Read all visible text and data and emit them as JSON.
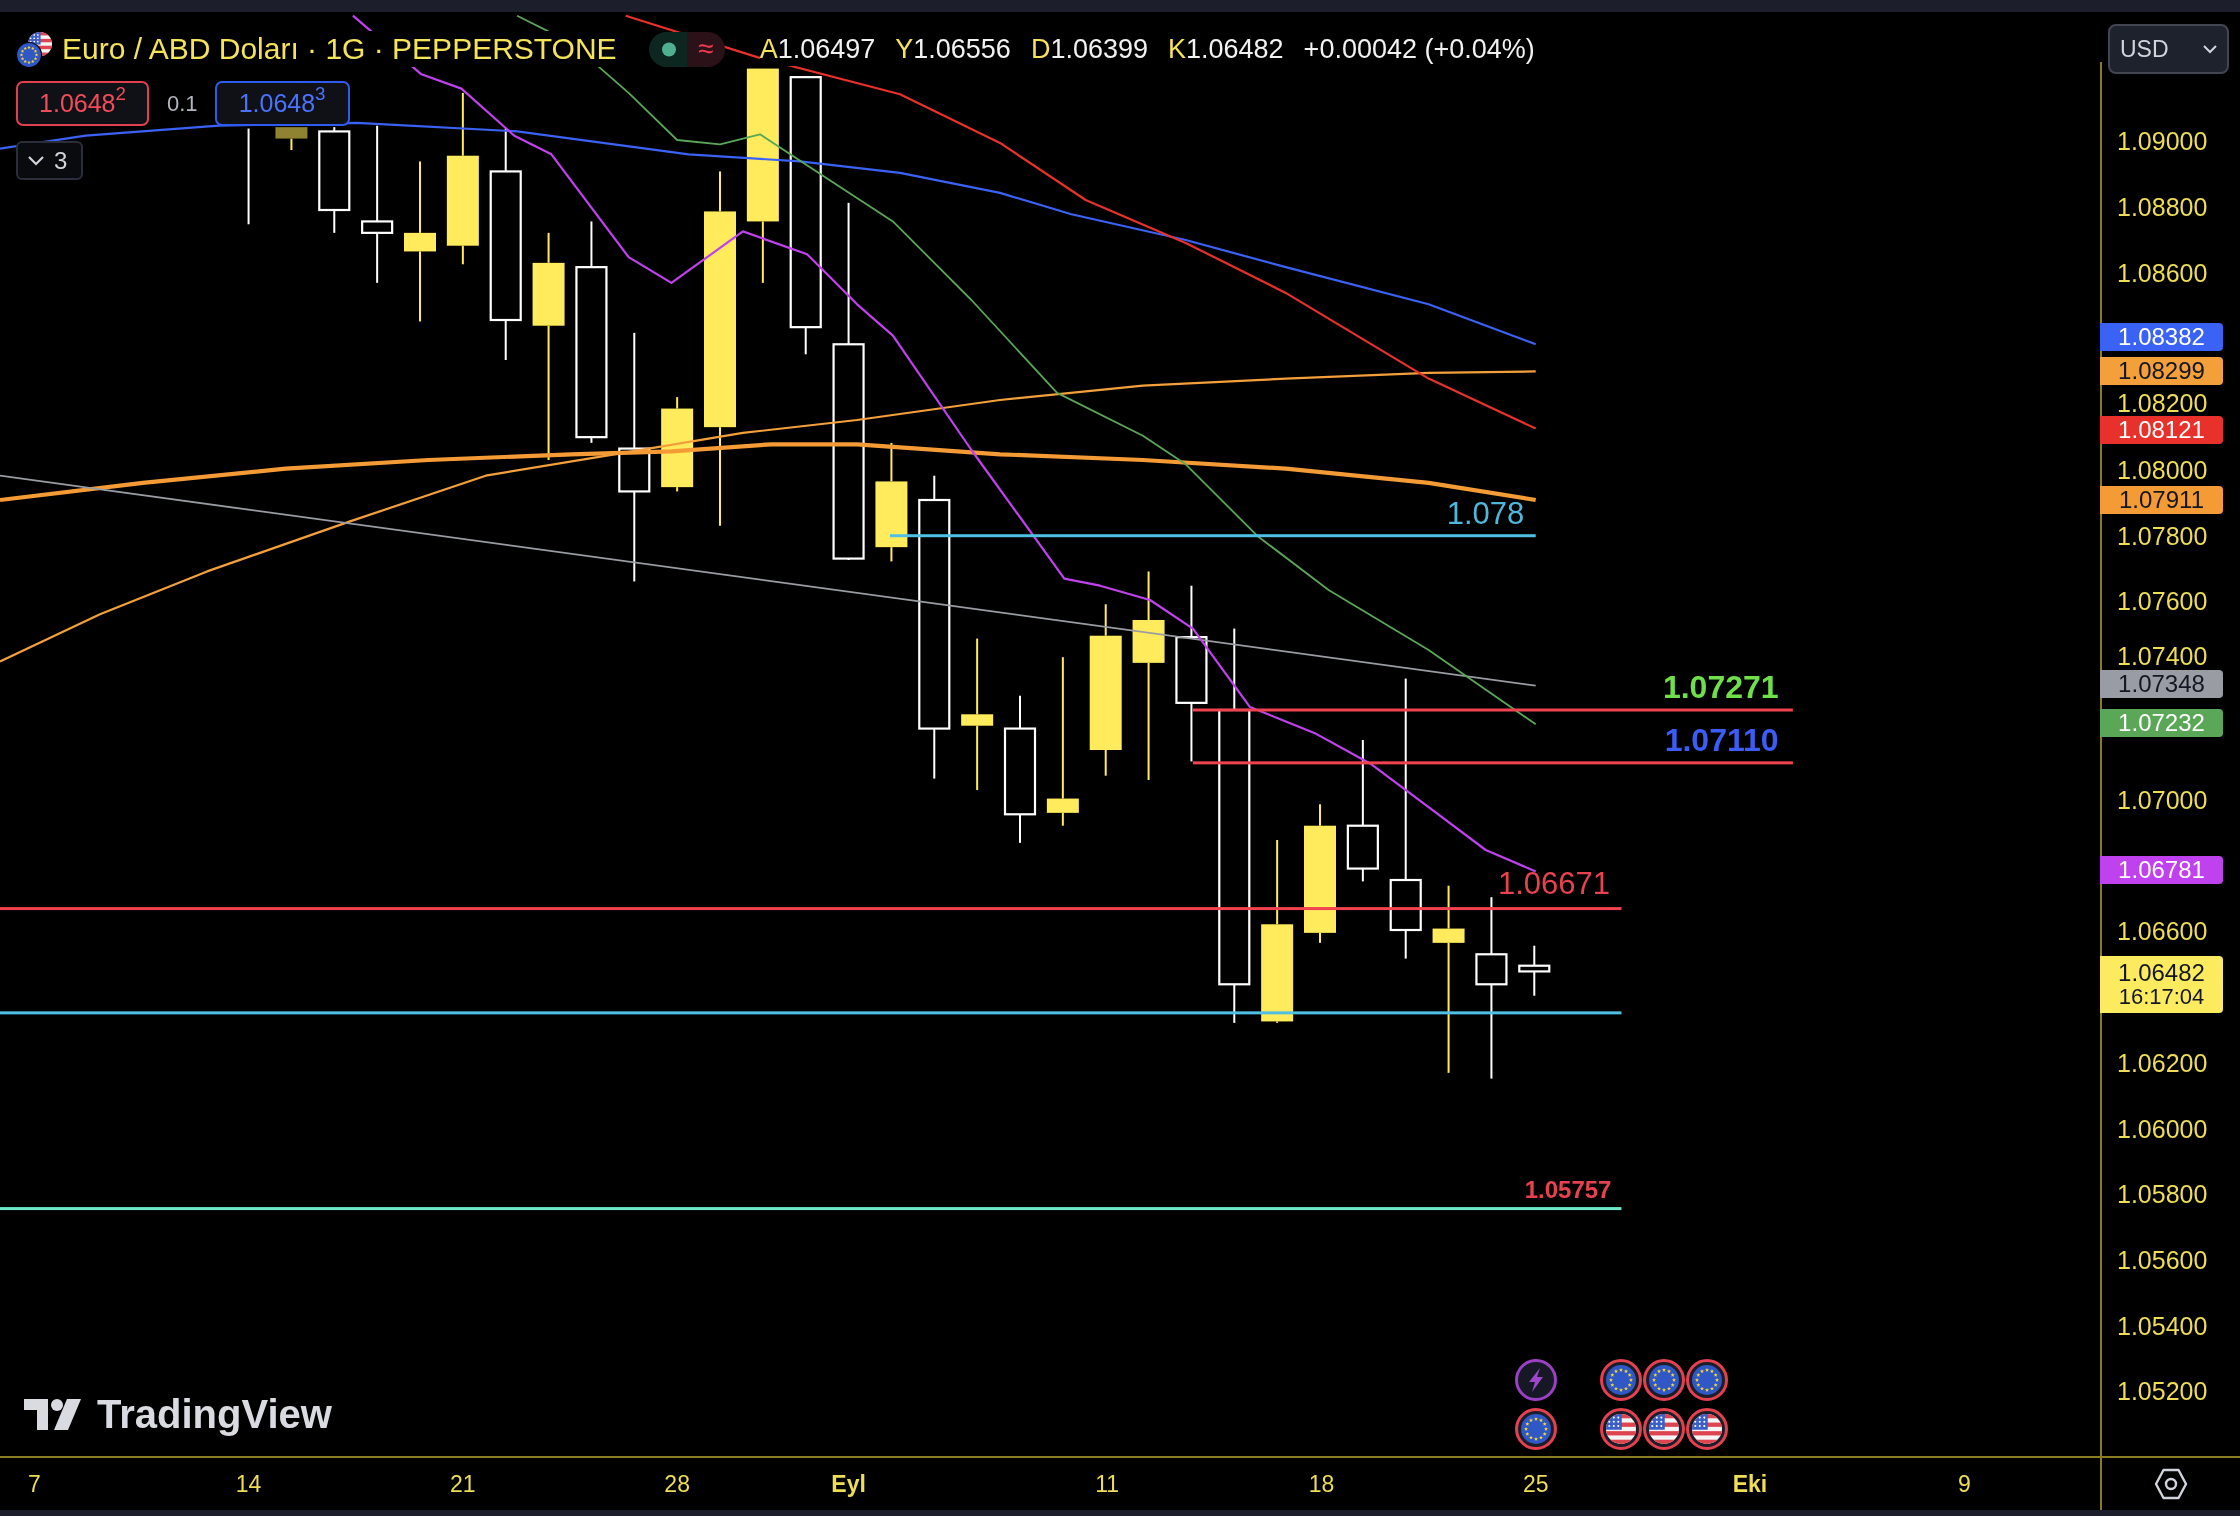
{
  "legend": {
    "symbol": "Euro / ABD Doları · 1G · PEPPERSTONE",
    "market_open": true,
    "data_flag": "≈",
    "ohlc": [
      {
        "key": "A",
        "value": "1.06497"
      },
      {
        "key": "Y",
        "value": "1.06556"
      },
      {
        "key": "D",
        "value": "1.06399"
      },
      {
        "key": "K",
        "value": "1.06482"
      }
    ],
    "change": "+0.00042 (+0.04%)"
  },
  "trade": {
    "sell": "1.0648$^{2}$",
    "spread": "0.1",
    "buy": "1.0648$^{3}$"
  },
  "indicators_toggle": {
    "count": "3",
    "expanded": false
  },
  "currency": "USD",
  "chart": {
    "indicators": [
      {
        "kind": "moving_average",
        "color": "#3a62f5",
        "reading": "1.08382"
      },
      {
        "kind": "moving_average",
        "color": "#f4a03a",
        "reading": "1.08299"
      },
      {
        "kind": "moving_average",
        "color": "#e8312a",
        "reading": "1.08121"
      },
      {
        "kind": "moving_average",
        "color": "#f59b35",
        "reading": "1.07911"
      },
      {
        "kind": "trend_line",
        "color": "#9a9ca3",
        "reading": "1.07348"
      },
      {
        "kind": "moving_average",
        "color": "#5aa757",
        "reading": "1.07232"
      },
      {
        "kind": "moving_average",
        "color": "#c041ee",
        "reading": "1.06781"
      }
    ],
    "levels": [
      {
        "color": "#4fc0e3",
        "label": {
          "text": "1.078",
          "color": "#4fb6dc",
          "bold": false
        }
      },
      {
        "color": "#f0424f",
        "label": {
          "text": "1.07271",
          "color": "#6fe04a",
          "bold": true
        }
      },
      {
        "color": "#f0424f",
        "label": {
          "text": "1.07110",
          "color": "#3b5cf5",
          "bold": true
        }
      },
      {
        "color": "#f0424f",
        "label": {
          "text": "1.06671",
          "color": "#e8414f",
          "bold": false
        }
      },
      {
        "color": "#4fc0e3"
      },
      {
        "color": "#6ee8c8",
        "label": {
          "text": "1.05757",
          "color": "#e8414f",
          "bold": true
        }
      }
    ],
    "events": [
      {
        "items": [
          {
            "kind": "lightning"
          },
          {
            "kind": "eu"
          }
        ]
      },
      {
        "items": [
          {
            "kind": "eu"
          },
          {
            "kind": "us"
          }
        ]
      },
      {
        "items": [
          {
            "kind": "eu"
          },
          {
            "kind": "us"
          }
        ]
      },
      {
        "items": [
          {
            "kind": "eu"
          },
          {
            "kind": "us"
          }
        ]
      }
    ],
    "branding": "TradingView"
  },
  "price_axis": {
    "ticks": [
      "1.09000",
      "1.08800",
      "1.08600",
      "1.08200",
      "1.08000",
      "1.07800",
      "1.07600",
      "1.07400",
      "1.07000",
      "1.06600",
      "1.06200",
      "1.06000",
      "1.05800",
      "1.05600",
      "1.05400",
      "1.05200"
    ],
    "last_price": {
      "value": "1.06482",
      "countdown": "16:17:04"
    }
  },
  "time_axis": [
    {
      "text": "7",
      "kind": "day"
    },
    {
      "text": "14",
      "kind": "day"
    },
    {
      "text": "21",
      "kind": "day"
    },
    {
      "text": "28",
      "kind": "day"
    },
    {
      "text": "Eyl",
      "kind": "month"
    },
    {
      "text": "11",
      "kind": "day"
    },
    {
      "text": "18",
      "kind": "day"
    },
    {
      "text": "25",
      "kind": "day"
    },
    {
      "text": "Eki",
      "kind": "month"
    },
    {
      "text": "9",
      "kind": "day"
    }
  ]
}
